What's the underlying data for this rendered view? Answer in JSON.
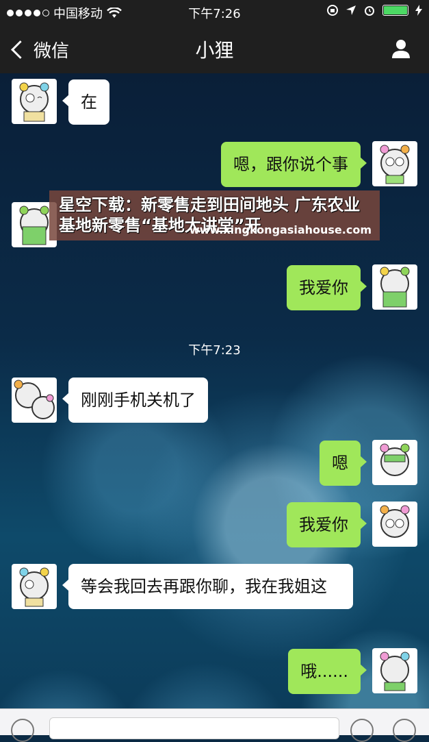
{
  "status_bar": {
    "carrier": "中国移动",
    "time": "下午7:26"
  },
  "nav": {
    "back_label": "微信",
    "title": "小狸"
  },
  "messages": [
    {
      "side": "in",
      "text": "在"
    },
    {
      "side": "out",
      "text": "嗯，跟你说个事"
    },
    {
      "side": "out",
      "text": "我爱你"
    },
    {
      "side": "in",
      "text": "刚刚手机关机了"
    },
    {
      "side": "out",
      "text": "嗯"
    },
    {
      "side": "out",
      "text": "我爱你"
    },
    {
      "side": "in",
      "text": "等会我回去再跟你聊，我在我姐这"
    },
    {
      "side": "out",
      "text": "哦......"
    }
  ],
  "timestamp": "下午7:23",
  "watermark": {
    "title": "星空下载：新零售走到田间地头 广东农业基地新零售“基地大讲堂”开",
    "url": "www.xingkongasiahouse.com"
  },
  "colors": {
    "out_bubble": "#a0e75a",
    "in_bubble": "#ffffff",
    "bar": "#1f1f1f",
    "battery": "#4cd964"
  }
}
